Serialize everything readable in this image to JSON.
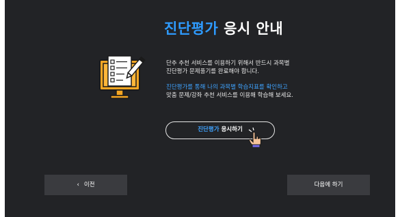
{
  "title": {
    "accent": "진단평가",
    "rest": "응시 안내"
  },
  "illustration": {
    "icon": "test-document-monitor-icon"
  },
  "description": {
    "line1": "단추 추천 서비스를 이용하기 위해서 반드시 과목별",
    "line2": "진단평가 문제풀기를 완료해야 합니다.",
    "line3": "진단평가를 통해 나의 과목별 학습지표를 확인하고",
    "line4": "맞춤 문제/강좌 추천 서비스를 이용해 학습해 보세요."
  },
  "cta": {
    "accent": "진단평가",
    "rest": "응시하기",
    "cursor_icon": "hand-pointer-icon"
  },
  "buttons": {
    "prev_icon": "chevron-left-icon",
    "prev_glyph": "‹",
    "prev_label": "이전",
    "later_label": "다음에 하기"
  },
  "colors": {
    "background": "#222326",
    "accent": "#2e9bff",
    "button": "#3a3b3f",
    "illustration_orange": "#f5a623"
  }
}
